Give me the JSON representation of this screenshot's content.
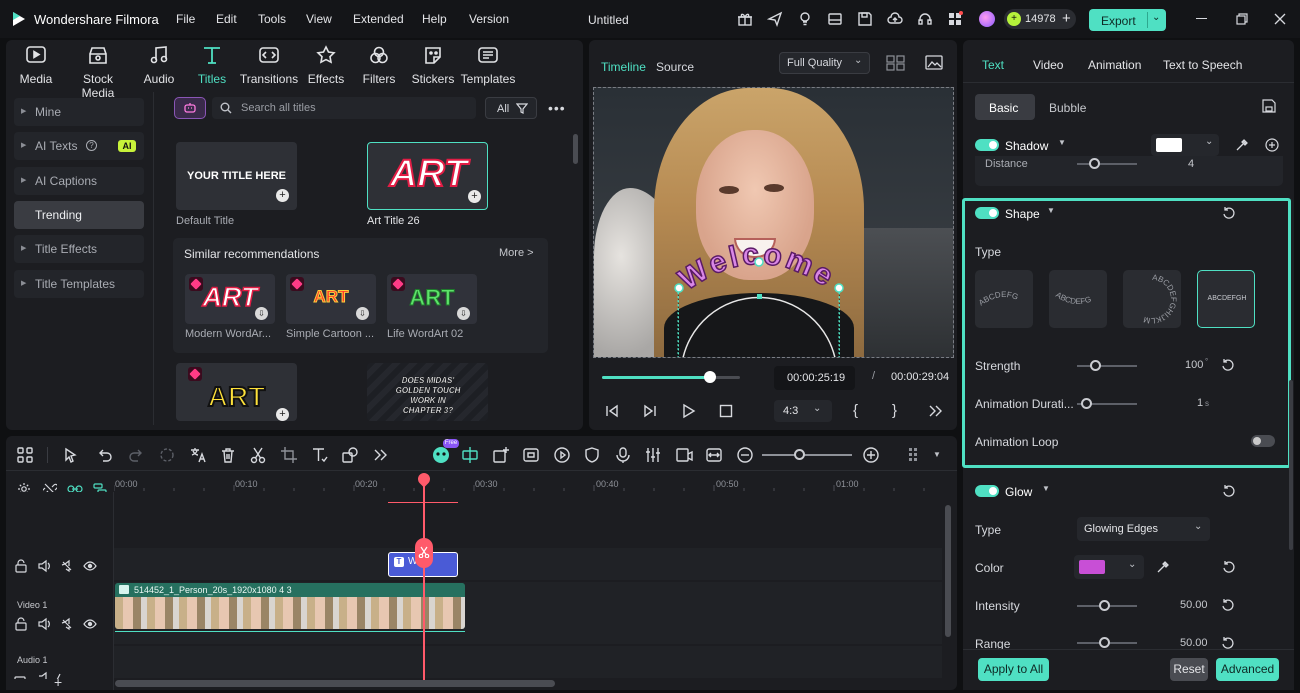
{
  "app": {
    "name": "Wondershare Filmora",
    "doc_title": "Untitled",
    "credits": "14978",
    "export_label": "Export"
  },
  "menu": [
    "File",
    "Edit",
    "Tools",
    "View",
    "Extended",
    "Help",
    "Version"
  ],
  "media_tabs": [
    {
      "label": "Media",
      "icon": "media-icon"
    },
    {
      "label": "Stock Media",
      "icon": "stock-media-icon"
    },
    {
      "label": "Audio",
      "icon": "music-note-icon"
    },
    {
      "label": "Titles",
      "icon": "text-t-icon"
    },
    {
      "label": "Transitions",
      "icon": "transitions-icon"
    },
    {
      "label": "Effects",
      "icon": "effects-icon"
    },
    {
      "label": "Filters",
      "icon": "filters-icon"
    },
    {
      "label": "Stickers",
      "icon": "stickers-icon"
    },
    {
      "label": "Templates",
      "icon": "templates-icon"
    }
  ],
  "sidebar": [
    "Mine",
    "AI Texts",
    "AI Captions",
    "Trending",
    "Title Effects",
    "Title Templates"
  ],
  "ai_badge": "AI",
  "search": {
    "placeholder": "Search all titles",
    "filter_label": "All"
  },
  "titles": {
    "default_thumb_text": "YOUR TITLE HERE",
    "default_caption": "Default Title",
    "art26_text": "ART",
    "art26_caption": "Art Title 26",
    "similar_label": "Similar recommendations",
    "more_label": "More >",
    "recs": [
      {
        "text": "ART",
        "caption": "Modern WordAr..."
      },
      {
        "text": "ART",
        "caption": "Simple Cartoon ..."
      },
      {
        "text": "ART",
        "caption": "Life WordArt 02"
      }
    ],
    "yellow_art": "ART",
    "comic_text": "DOES MIDAS' GOLDEN TOUCH WORK IN CHAPTER 3?"
  },
  "player": {
    "tab_timeline": "Timeline",
    "tab_source": "Source",
    "quality": "Full Quality",
    "current_time": "00:00:25:19",
    "separator": "/",
    "total_time": "00:00:29:04",
    "aspect": "4:3",
    "overlay_text": "Welcome",
    "progress": 0.78
  },
  "right_panel": {
    "tabs": [
      "Text",
      "Video",
      "Animation",
      "Text to Speech"
    ],
    "subtabs": [
      "Basic",
      "Bubble"
    ],
    "shadow_label": "Shadow",
    "distance_label": "Distance",
    "distance_value": "4",
    "shape_label": "Shape",
    "type_label": "Type",
    "shape_samples": [
      "ABCDEFG",
      "ABCDEFG",
      "ABCDEFGHIJKLM",
      "ABCDEFGH"
    ],
    "strength_label": "Strength",
    "strength_value": "100",
    "strength_unit": "°",
    "anim_duration_label": "Animation Durati...",
    "anim_duration_value": "1",
    "anim_duration_unit": "s",
    "anim_loop_label": "Animation Loop",
    "glow_label": "Glow",
    "glow_type_label": "Type",
    "glow_type_value": "Glowing Edges",
    "color_label": "Color",
    "intensity_label": "Intensity",
    "intensity_value": "50.00",
    "range_label": "Range",
    "range_value": "50.00",
    "apply_all": "Apply to All",
    "reset": "Reset",
    "advanced": "Advanced",
    "colors": {
      "shadow_swatch": "#ffffff",
      "glow_swatch": "#c84fd6"
    }
  },
  "timeline": {
    "ruler": [
      "00:00",
      "00:10",
      "00:20",
      "00:30",
      "00:40",
      "00:50",
      "01:00"
    ],
    "title_clip_text": "W",
    "video_clip_name": "514452_1_Person_20s_1920x1080 4 3",
    "video_track_label": "Video 1",
    "audio_track_label": "Audio 1",
    "free_badge": "Free"
  }
}
